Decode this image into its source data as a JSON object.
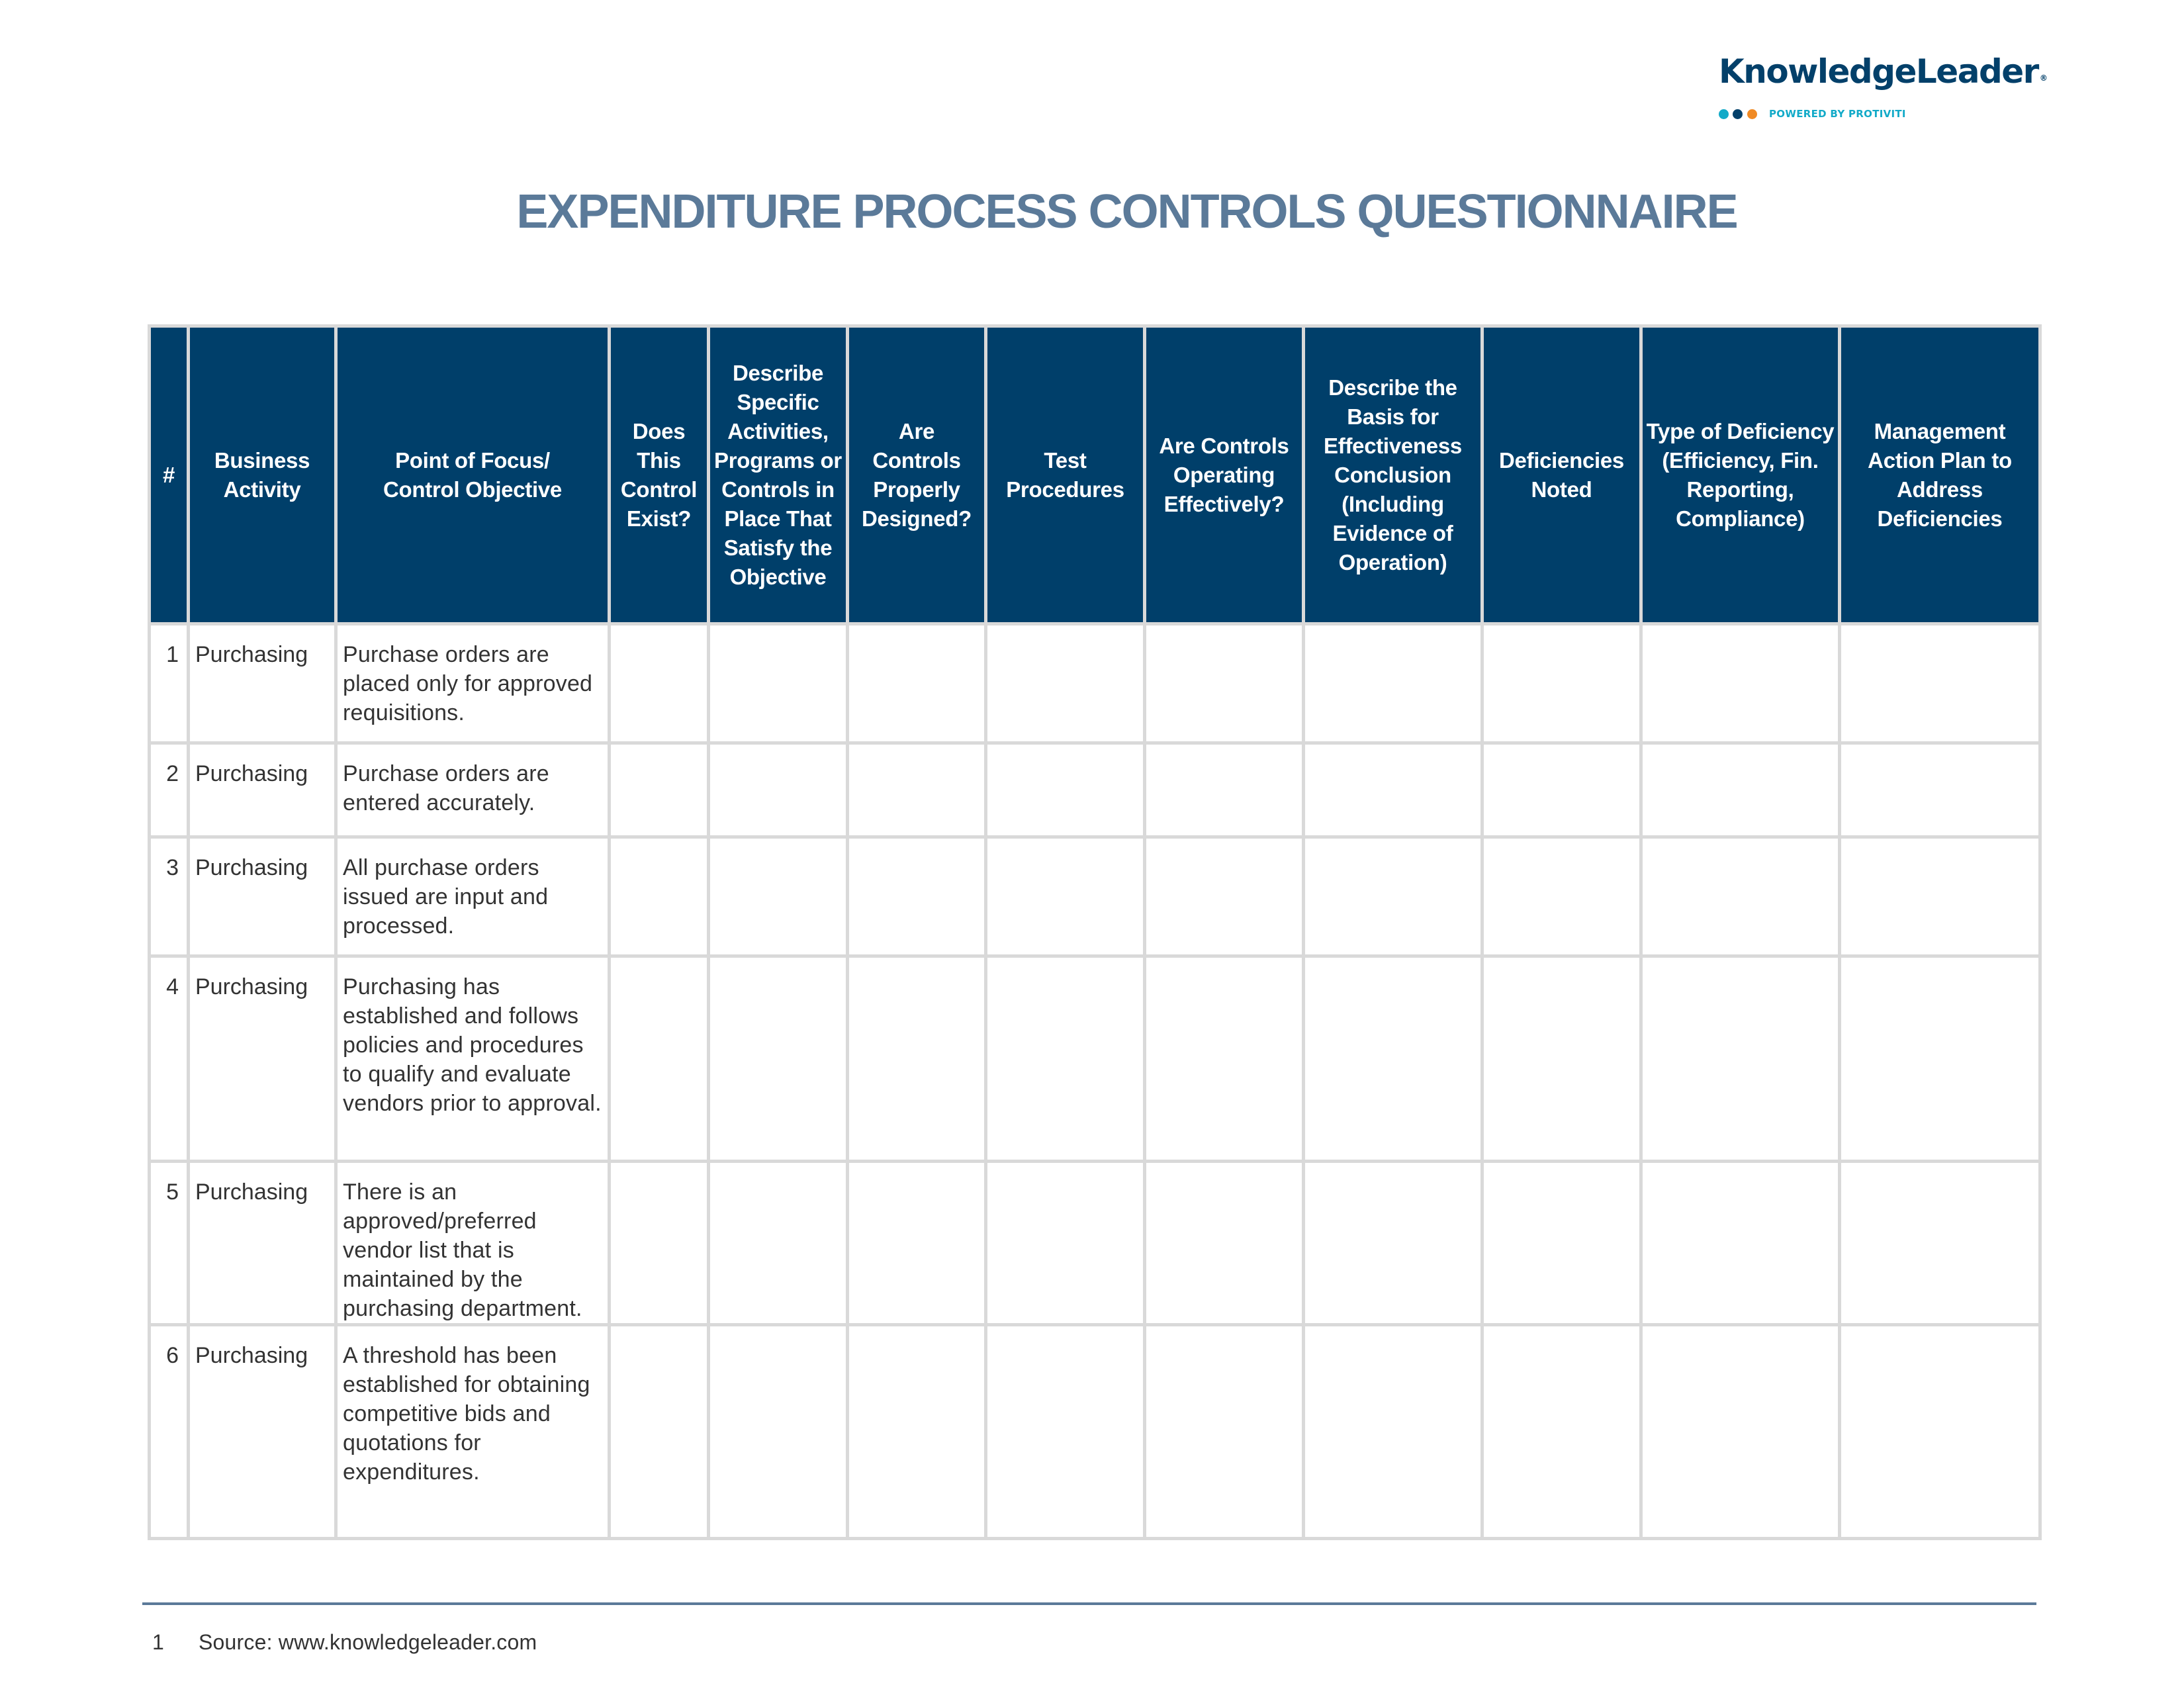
{
  "colors": {
    "brand_navy": "#03406a",
    "header_fill": "#003f6a",
    "title_slate": "#5b7a99",
    "grid_gray": "#d9d9d9",
    "dot_teal": "#12aac8",
    "dot_navy": "#03406a",
    "dot_orange": "#f08a24",
    "powered_teal": "#12aac8",
    "footer_rule": "#5b7a99"
  },
  "logo": {
    "name": "KnowledgeLeader",
    "registered_mark": "®",
    "tagline": "POWERED BY PROTIVITI",
    "dots": [
      "teal-dot",
      "navy-dot",
      "orange-dot"
    ]
  },
  "title": "EXPENDITURE PROCESS CONTROLS QUESTIONNAIRE",
  "table": {
    "columns": [
      "#",
      "Business Activity",
      "Point of Focus/ Control Objective",
      "Does This Control Exist?",
      "Describe Specific Activities, Programs or Controls in Place That Satisfy the Objective",
      "Are Controls Properly Designed?",
      "Test Procedures",
      "Are Controls Operating Effectively?",
      "Describe the Basis for Effectiveness Conclusion (Including Evidence of Operation)",
      "Deficiencies Noted",
      "Type of Deficiency (Efficiency, Fin. Reporting, Compliance)",
      "Management Action Plan to Address Deficiencies"
    ],
    "rows": [
      {
        "num": "1",
        "activity": "Purchasing",
        "objective": "Purchase orders are placed only for approved requisitions.",
        "exists": "",
        "describe": "",
        "designed": "",
        "test": "",
        "operating": "",
        "basis": "",
        "deficiencies": "",
        "type": "",
        "plan": ""
      },
      {
        "num": "2",
        "activity": "Purchasing",
        "objective": "Purchase orders are entered accurately.",
        "exists": "",
        "describe": "",
        "designed": "",
        "test": "",
        "operating": "",
        "basis": "",
        "deficiencies": "",
        "type": "",
        "plan": ""
      },
      {
        "num": "3",
        "activity": "Purchasing",
        "objective": "All purchase orders issued are input and processed.",
        "exists": "",
        "describe": "",
        "designed": "",
        "test": "",
        "operating": "",
        "basis": "",
        "deficiencies": "",
        "type": "",
        "plan": ""
      },
      {
        "num": "4",
        "activity": "Purchasing",
        "objective": "Purchasing has established and follows policies and procedures to qualify and evaluate vendors prior to approval.",
        "exists": "",
        "describe": "",
        "designed": "",
        "test": "",
        "operating": "",
        "basis": "",
        "deficiencies": "",
        "type": "",
        "plan": ""
      },
      {
        "num": "5",
        "activity": "Purchasing",
        "objective": "There is an approved/preferred vendor list that is maintained by the purchasing department.",
        "exists": "",
        "describe": "",
        "designed": "",
        "test": "",
        "operating": "",
        "basis": "",
        "deficiencies": "",
        "type": "",
        "plan": ""
      },
      {
        "num": "6",
        "activity": "Purchasing",
        "objective": "A threshold has been established for obtaining competitive bids and quotations for expenditures.",
        "exists": "",
        "describe": "",
        "designed": "",
        "test": "",
        "operating": "",
        "basis": "",
        "deficiencies": "",
        "type": "",
        "plan": ""
      }
    ]
  },
  "footer": {
    "page_number": "1",
    "source": "Source: www.knowledgeleader.com"
  }
}
